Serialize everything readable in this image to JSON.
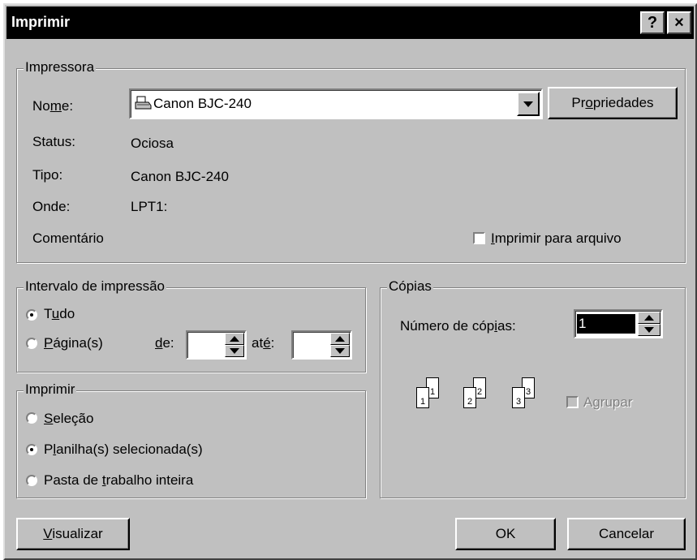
{
  "window": {
    "title": "Imprimir",
    "help_glyph": "?",
    "close_glyph": "×"
  },
  "printer": {
    "group_label": "Impressora",
    "name_label": [
      "No",
      "m",
      "e:"
    ],
    "name_value": "Canon  BJC-240",
    "properties_button": [
      "Pr",
      "o",
      "priedades"
    ],
    "status_label": "Status:",
    "status_value": "Ociosa",
    "type_label": "Tipo:",
    "type_value": "Canon  BJC-240",
    "where_label": "Onde:",
    "where_value": "LPT1:",
    "comment_label": "Comentário",
    "print_to_file": [
      "",
      "I",
      "mprimir para arquivo"
    ],
    "print_to_file_checked": false
  },
  "range": {
    "group_label": "Intervalo de impressão",
    "all_option": [
      "T",
      "u",
      "do"
    ],
    "pages_option": [
      "",
      "P",
      "ágina(s)"
    ],
    "from_label": [
      "",
      "d",
      "e:"
    ],
    "to_label": [
      "at",
      "é",
      ":"
    ],
    "from_value": "",
    "to_value": "",
    "selected": "all"
  },
  "print_what": {
    "group_label": "Imprimir",
    "selection_option": [
      "",
      "S",
      "eleção"
    ],
    "sheets_option": [
      "P",
      "l",
      "anilha(s) selecionada(s)"
    ],
    "workbook_option": [
      "Pasta de ",
      "t",
      "rabalho inteira"
    ],
    "selected": "sheets"
  },
  "copies": {
    "group_label": "Cópias",
    "count_label": [
      "Número de cóp",
      "i",
      "as:"
    ],
    "count_value": "1",
    "collate_label": "Agrupar",
    "collate_enabled": false,
    "page_numbers": [
      "1",
      "1",
      "2",
      "2",
      "3",
      "3"
    ]
  },
  "buttons": {
    "preview": [
      "",
      "V",
      "isualizar"
    ],
    "ok": "OK",
    "cancel": "Cancelar"
  }
}
